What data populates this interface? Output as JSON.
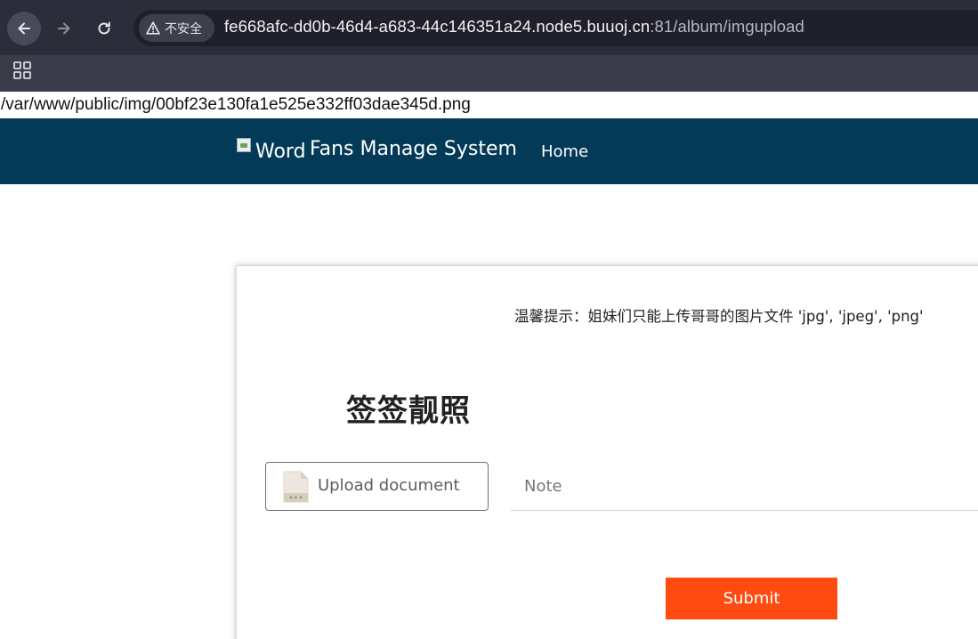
{
  "browser": {
    "security_label": "不安全",
    "url_host": "fe668afc-dd0b-46d4-a683-44c146351a24.node5.buuoj.cn",
    "url_rest": ":81/album/imgupload"
  },
  "page": {
    "path_output": "/var/www/public/img/00bf23e130fa1e525e332ff03dae345d.png"
  },
  "navbar": {
    "brand_alt": "Word",
    "brand_title": "Fans Manage System",
    "home_label": "Home"
  },
  "form": {
    "tip": "温馨提示：姐妹们只能上传哥哥的图片文件 'jpg', 'jpeg', 'png'",
    "title": "签签靓照",
    "upload_label": "Upload document",
    "note_placeholder": "Note",
    "submit_label": "Submit"
  },
  "colors": {
    "navbar_bg": "#033a57",
    "submit_bg": "#ff4b0f",
    "chrome_bg": "#2b2d3a"
  }
}
